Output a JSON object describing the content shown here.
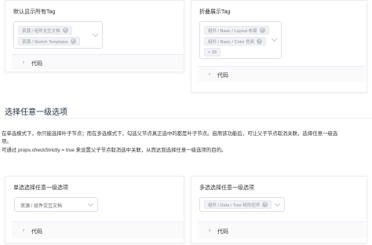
{
  "cards": {
    "default_tags": {
      "title": "默认显示所有Tag",
      "tags": [
        "资源 / 组件交互文档",
        "资源 / Sketch Templates"
      ],
      "code_label": "代码"
    },
    "collapse_tags": {
      "title": "折叠展示Tag",
      "tags": [
        "组件 / Basic / Layout 布局",
        "组件 / Basic / Color 色彩"
      ],
      "more_label": "+ 39",
      "code_label": "代码"
    },
    "single_select": {
      "title": "单选选择任意一级选项",
      "value": "资源 / 组件交互文档",
      "code_label": "代码"
    },
    "multi_select": {
      "title": "多选选择任意一级选项",
      "tags": [
        "组件 / Data / Tree 树形控件"
      ],
      "code_label": "代码"
    }
  },
  "section": {
    "heading": "选择任意一级选项",
    "desc_line1": "在单选模式下，你只能选择叶子节点；而在多选模式下，勾选父节点真正选中的都是叶子节点。启用该功能后，可让父子节点取消关联，选择任意一级选",
    "desc_line2": "项。",
    "desc_line3": "可通过 props.checkStrictly = true 来设置父子节点取消选中关联，从而达到选择任意一级选项的目的。"
  },
  "icons": {
    "tag_close": "close-circle-icon",
    "dropdown": "chevron-down-icon",
    "code_expand": "caret-right-icon"
  },
  "colors": {
    "tag_bg": "#f0f2f5",
    "tag_text": "#909399",
    "border": "#dcdfe6",
    "code_bar": "#fafafa"
  }
}
